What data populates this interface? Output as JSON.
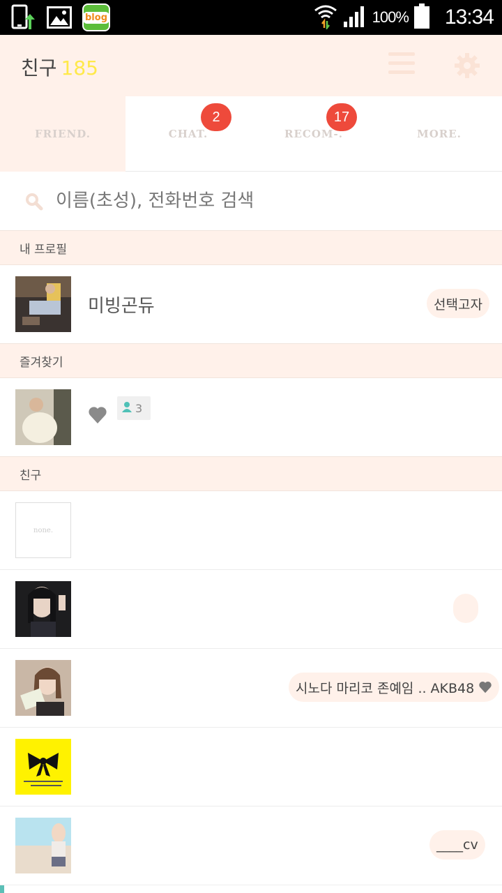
{
  "status_bar": {
    "blog_label": "blog",
    "battery": "100%",
    "time": "13:34"
  },
  "header": {
    "title": "친구",
    "count": "185"
  },
  "tabs": [
    {
      "label": "FRIEND.",
      "badge": ""
    },
    {
      "label": "CHAT.",
      "badge": "2"
    },
    {
      "label": "RECOM-.",
      "badge": "17"
    },
    {
      "label": "MORE.",
      "badge": ""
    }
  ],
  "search": {
    "placeholder": "이름(초성), 전화번호 검색"
  },
  "sections": {
    "my_profile": "내 프로필",
    "favorites": "즐겨찾기",
    "friends": "친구"
  },
  "my_profile": {
    "name": "미빙곤듀",
    "status": "선택고자"
  },
  "favorites": [
    {
      "name": "",
      "friend_count": "3"
    }
  ],
  "friends": [
    {
      "name": "",
      "status": "",
      "avatar_text": "none."
    },
    {
      "name": "",
      "status": ""
    },
    {
      "name": "",
      "status": "시노다 마리코 존예임 .. AKB48"
    },
    {
      "name": "",
      "status": ""
    },
    {
      "name": "",
      "status": "____cv"
    }
  ],
  "colors": {
    "header_bg": "#fff1ea",
    "badge": "#ee4a3b",
    "count_yellow": "#ffe94a",
    "accent_teal": "#5bbfb6"
  }
}
